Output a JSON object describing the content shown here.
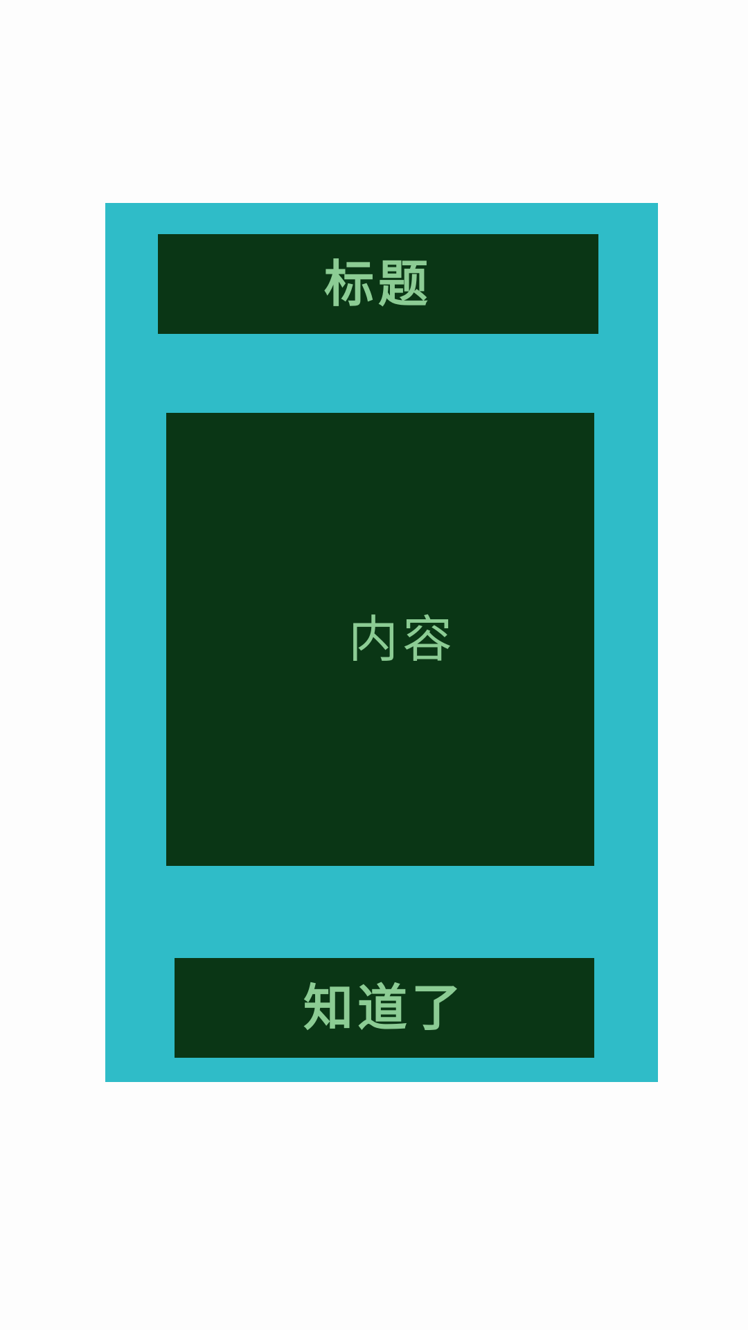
{
  "dialog": {
    "title": "标题",
    "content": "内容",
    "confirm_label": "知道了"
  },
  "colors": {
    "page_background": "#fdfdfd",
    "dialog_background": "#2fbcc8",
    "box_background": "#0a3615",
    "text": "#8ccc94"
  }
}
